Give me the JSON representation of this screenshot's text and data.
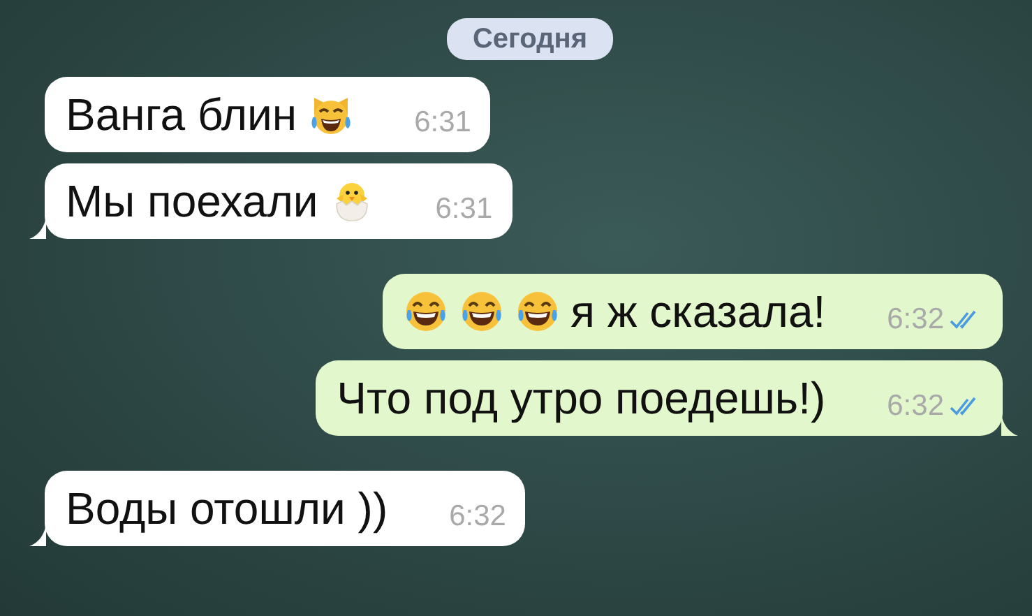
{
  "date_badge": "Сегодня",
  "messages": [
    {
      "kind": "incoming",
      "tail": false,
      "parts": [
        {
          "kind": "text",
          "text": "Ванга блин"
        },
        {
          "kind": "cat-laugh"
        }
      ],
      "time": "6:31"
    },
    {
      "kind": "incoming",
      "tail": true,
      "parts": [
        {
          "kind": "text",
          "text": "Мы поехали"
        },
        {
          "kind": "chick"
        }
      ],
      "time": "6:31"
    },
    {
      "kind": "outgoing",
      "tail": false,
      "read": true,
      "parts": [
        {
          "kind": "laugh"
        },
        {
          "kind": "laugh"
        },
        {
          "kind": "laugh"
        },
        {
          "kind": "text",
          "text": "я ж сказала!"
        }
      ],
      "time": "6:32"
    },
    {
      "kind": "outgoing",
      "tail": true,
      "read": true,
      "parts": [
        {
          "kind": "text",
          "text": "Что под утро поедешь!)"
        }
      ],
      "time": "6:32"
    },
    {
      "kind": "incoming",
      "tail": true,
      "parts": [
        {
          "kind": "text",
          "text": "Воды отошли ))"
        }
      ],
      "time": "6:32"
    }
  ]
}
